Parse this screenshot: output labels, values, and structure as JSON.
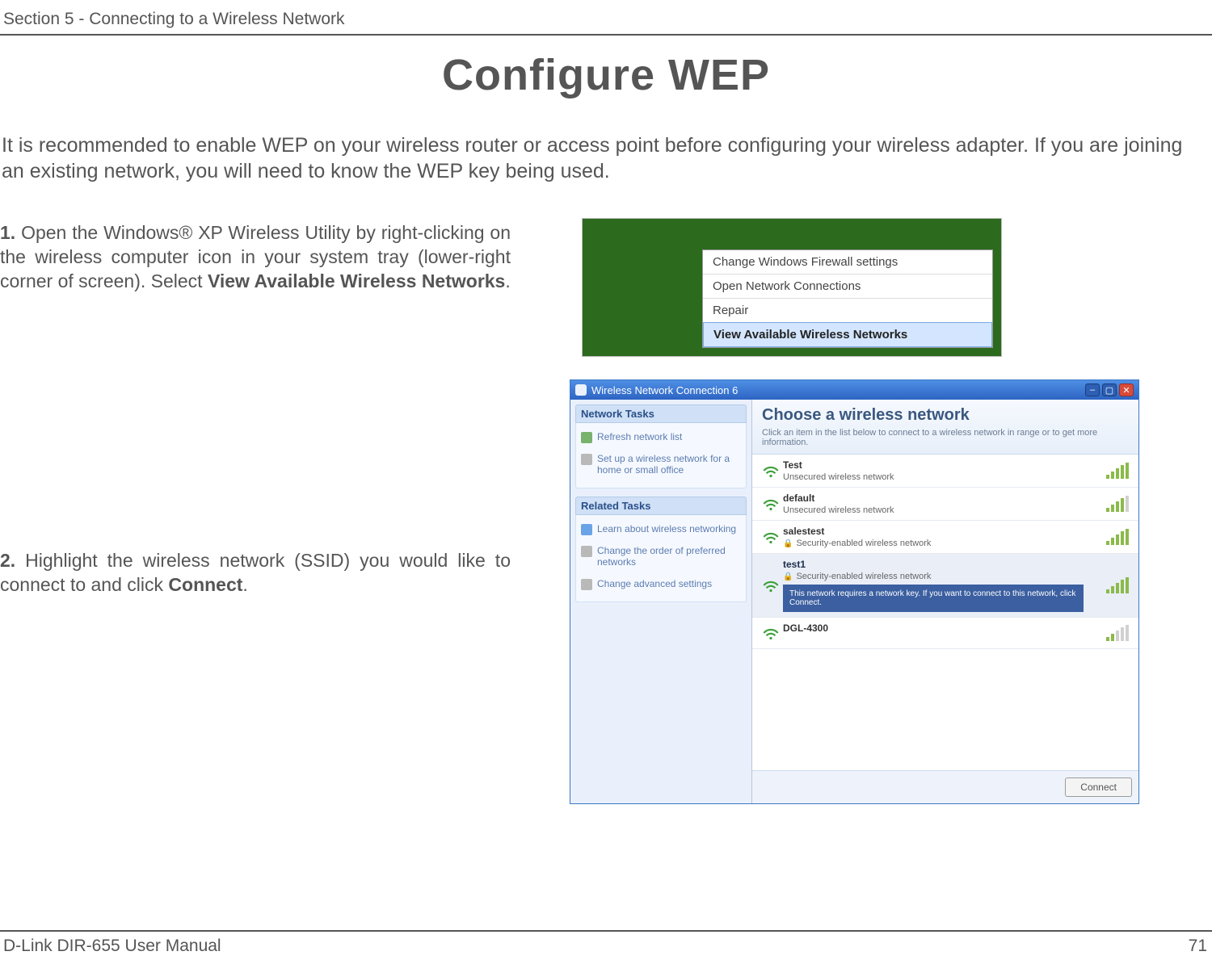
{
  "header": {
    "section": "Section 5 - Connecting to a Wireless Network"
  },
  "title": "Configure WEP",
  "intro": "It is recommended to enable WEP on your wireless router or access point before configuring your wireless adapter. If you are joining an existing network, you will need to know the WEP key being used.",
  "steps": {
    "s1": {
      "num": "1.",
      "text_before": " Open the Windows® XP Wireless Utility by right-clicking on the wireless computer icon in your system tray (lower-right corner of screen). Select ",
      "bold": "View Available Wireless Networks",
      "text_after": "."
    },
    "s2": {
      "num": "2.",
      "text_before": " Highlight the wireless network (SSID) you would like to connect to and click ",
      "bold": "Connect",
      "text_after": "."
    }
  },
  "fig1": {
    "items": [
      "Change Windows Firewall settings",
      "Open Network Connections",
      "Repair",
      "View Available Wireless Networks"
    ]
  },
  "fig2": {
    "window_title": "Wireless Network Connection 6",
    "sidebar": {
      "group1": {
        "title": "Network Tasks",
        "links": [
          "Refresh network list",
          "Set up a wireless network for a home or small office"
        ]
      },
      "group2": {
        "title": "Related Tasks",
        "links": [
          "Learn about wireless networking",
          "Change the order of preferred networks",
          "Change advanced settings"
        ]
      }
    },
    "main": {
      "heading": "Choose a wireless network",
      "sub": "Click an item in the list below to connect to a wireless network in range or to get more information.",
      "networks": [
        {
          "name": "Test",
          "sub": "Unsecured wireless network",
          "selected": false,
          "secure": false
        },
        {
          "name": "default",
          "sub": "Unsecured wireless network",
          "selected": false,
          "secure": false
        },
        {
          "name": "salestest",
          "sub": "Security-enabled wireless network",
          "selected": false,
          "secure": true
        },
        {
          "name": "test1",
          "sub": "Security-enabled wireless network",
          "selected": true,
          "secure": true
        },
        {
          "name": "DGL-4300",
          "sub": "",
          "selected": false,
          "secure": false
        }
      ],
      "selected_desc": "This network requires a network key. If you want to connect to this network, click Connect.",
      "connect": "Connect"
    }
  },
  "footer": {
    "left": "D-Link DIR-655 User Manual",
    "right": "71"
  }
}
